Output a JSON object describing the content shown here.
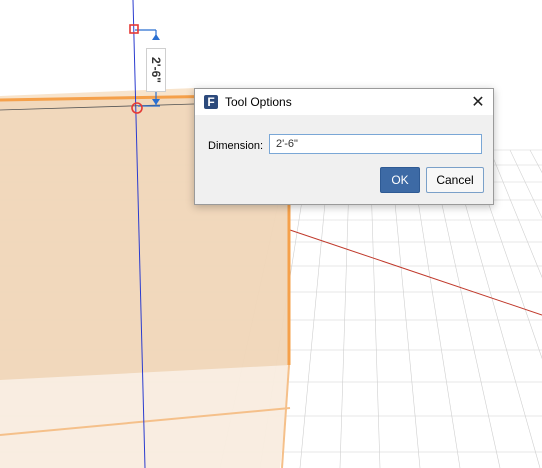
{
  "viewport": {
    "dimension_label": "2'-6\""
  },
  "dialog": {
    "title": "Tool Options",
    "app_icon": "F",
    "close_glyph": "✕",
    "dimension_label": "Dimension:",
    "dimension_value": "2'-6\"",
    "ok_label": "OK",
    "cancel_label": "Cancel"
  },
  "colors": {
    "box_fill": "#f0d6b8",
    "box_edge": "#f5a04a",
    "axis_x": "#c0392b",
    "axis_z": "#2b3ccf",
    "guide_point": "#e53935",
    "ok_button": "#3d6aa5"
  }
}
